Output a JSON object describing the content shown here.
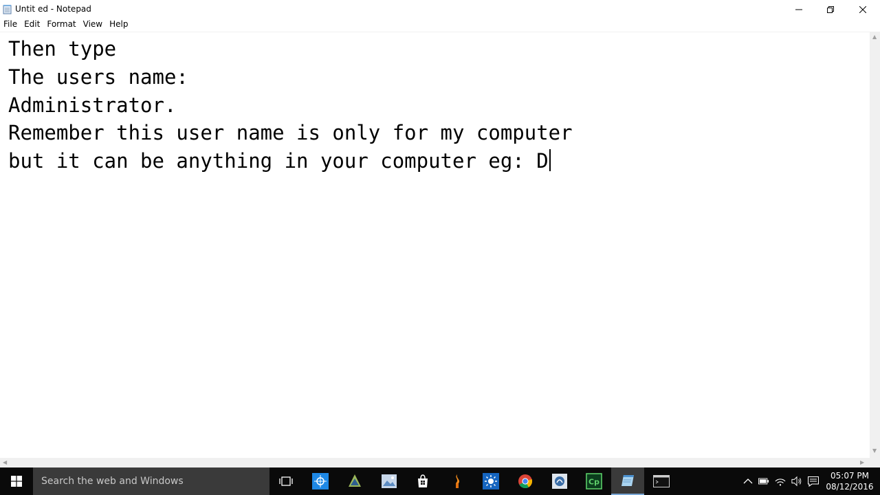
{
  "window": {
    "title": "Untit ed - Notepad"
  },
  "menu": {
    "items": [
      "File",
      "Edit",
      "Format",
      "View",
      "Help"
    ]
  },
  "editor": {
    "lines": [
      "Then type",
      "The users name:",
      "Administrator.",
      "Remember this user name is only for my computer",
      "but it can be anything in your computer eg: D"
    ]
  },
  "taskbar": {
    "search_placeholder": "Search the web and Windows",
    "clock_time": "05:07 PM",
    "clock_date": "08/12/2016",
    "apps": [
      "task-view-icon",
      "vpn-app-icon",
      "sticky-bird-icon",
      "photos-icon",
      "store-icon",
      "torch-app-icon",
      "sun-app-icon",
      "chrome-icon",
      "wifi-tool-icon",
      "captivate-icon",
      "notepad-icon",
      "terminal-icon"
    ]
  },
  "colors": {
    "taskbar_bg": "#0a0a0a",
    "search_bg": "#3a3a3a",
    "accent": "#7aa7d6"
  }
}
